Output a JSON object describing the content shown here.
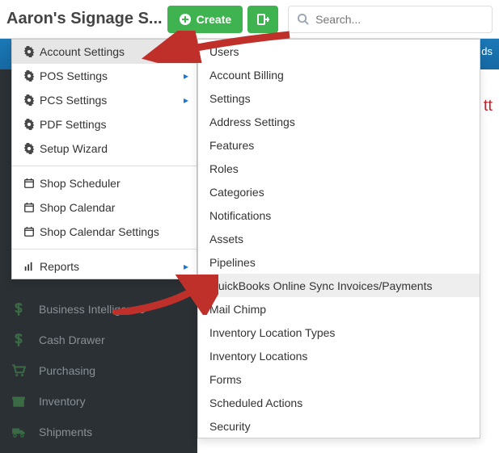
{
  "brand": "Aaron's Signage S...",
  "create_label": "Create",
  "search_placeholder": "Search...",
  "blue_label_text": "ds",
  "red_partial_text": "tt",
  "settings_menu": [
    {
      "label": "Account Settings",
      "icon": "gear",
      "hover": true
    },
    {
      "label": "POS Settings",
      "icon": "gear",
      "caret": true
    },
    {
      "label": "PCS Settings",
      "icon": "gear",
      "caret": true
    },
    {
      "label": "PDF Settings",
      "icon": "gear"
    },
    {
      "label": "Setup Wizard",
      "icon": "gear"
    },
    {
      "divider": true
    },
    {
      "label": "Shop Scheduler",
      "icon": "calendar"
    },
    {
      "label": "Shop Calendar",
      "icon": "calendar"
    },
    {
      "label": "Shop Calendar Settings",
      "icon": "calendar"
    },
    {
      "divider": true
    },
    {
      "label": "Reports",
      "icon": "bars",
      "caret": true
    }
  ],
  "submenu": [
    {
      "label": "Users"
    },
    {
      "label": "Account Billing"
    },
    {
      "label": "Settings"
    },
    {
      "label": "Address Settings"
    },
    {
      "label": "Features"
    },
    {
      "label": "Roles"
    },
    {
      "label": "Categories"
    },
    {
      "label": "Notifications"
    },
    {
      "label": "Assets"
    },
    {
      "label": "Pipelines"
    },
    {
      "label": "QuickBooks Online Sync Invoices/Payments",
      "hover": true
    },
    {
      "label": "Mail Chimp"
    },
    {
      "label": "Inventory Location Types"
    },
    {
      "label": "Inventory Locations"
    },
    {
      "label": "Forms"
    },
    {
      "label": "Scheduled Actions"
    },
    {
      "label": "Security"
    }
  ],
  "sidebar": [
    {
      "label": "Business Intelligence",
      "icon": "dollar"
    },
    {
      "label": "Cash Drawer",
      "icon": "dollar"
    },
    {
      "label": "Purchasing",
      "icon": "cart"
    },
    {
      "label": "Inventory",
      "icon": "box"
    },
    {
      "label": "Shipments",
      "icon": "truck"
    }
  ],
  "colors": {
    "green": "#3fb34f",
    "blue": "#1b78b6",
    "red_arrow": "#c0302a",
    "red_text": "#b8282f"
  }
}
